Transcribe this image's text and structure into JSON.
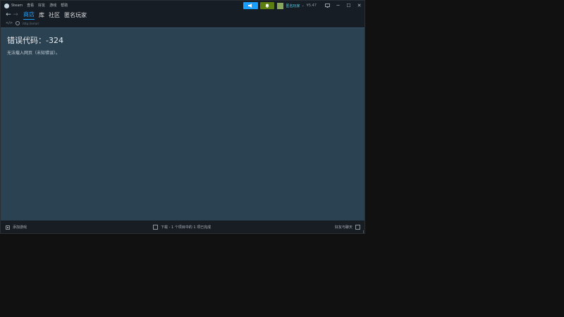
{
  "titlebar": {
    "app_name": "Steam",
    "menu": [
      "查看",
      "好友",
      "游戏",
      "帮助"
    ]
  },
  "account": {
    "user_name": "匿名玩家",
    "caret": "⌄",
    "wallet": "¥5.47"
  },
  "window_controls": {
    "minimize": "─",
    "maximize": "☐",
    "close": "✕"
  },
  "nav": {
    "back": "←",
    "forward": "→",
    "tabs": [
      "商店",
      "库",
      "社区",
      "匿名玩家"
    ],
    "active_tab": "商店"
  },
  "urlbar": {
    "code_symbol": "</>",
    "url": "http://error/"
  },
  "content": {
    "error_title": "错误代码：-324",
    "error_description": "无法载入网页（未知错误）。"
  },
  "statusbar": {
    "add_game": "添加游戏",
    "downloads": "下载 - 1 个项目中的 1 项已完成",
    "friends_chat": "好友与聊天"
  },
  "colors": {
    "accent": "#1a9fff",
    "notification": "#5c7e10",
    "content_bg": "#2b4253",
    "chrome_bg": "#171d25"
  },
  "icons": {
    "steam": "steam-logo-icon",
    "announce": "megaphone-icon",
    "notifications": "bell-icon",
    "monitor": "monitor-icon",
    "globe": "globe-icon",
    "add": "plus-square-icon",
    "download": "download-icon",
    "chat": "chat-icon"
  }
}
